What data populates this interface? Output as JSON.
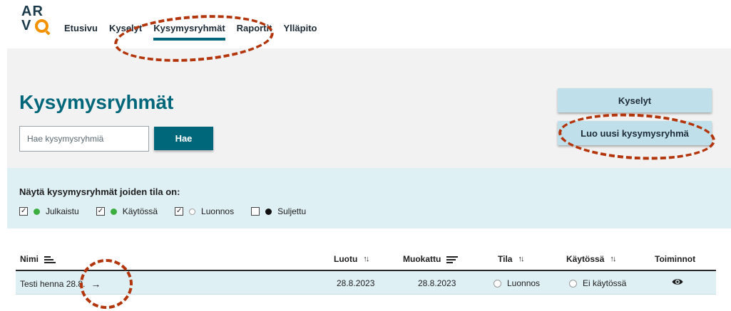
{
  "logo": {
    "line1": "AR",
    "line2": "V"
  },
  "nav": {
    "items": [
      {
        "label": "Etusivu"
      },
      {
        "label": "Kyselyt"
      },
      {
        "label": "Kysymysryhmät"
      },
      {
        "label": "Raportit"
      },
      {
        "label": "Ylläpito"
      }
    ],
    "active": "Kysymysryhmät"
  },
  "page": {
    "title": "Kysymysryhmät"
  },
  "search": {
    "placeholder": "Hae kysymysryhmiä",
    "value": "",
    "button": "Hae"
  },
  "actions": {
    "kyselyt": "Kyselyt",
    "create": "Luo uusi kysymysryhmä"
  },
  "filter": {
    "label": "Näytä kysymysryhmät joiden tila on:",
    "options": [
      {
        "label": "Julkaistu",
        "checked": true,
        "dot": "green"
      },
      {
        "label": "Käytössä",
        "checked": true,
        "dot": "green"
      },
      {
        "label": "Luonnos",
        "checked": true,
        "dot": "empty"
      },
      {
        "label": "Suljettu",
        "checked": false,
        "dot": "black"
      }
    ]
  },
  "table": {
    "columns": {
      "name": "Nimi",
      "created": "Luotu",
      "modified": "Muokattu",
      "state": "Tila",
      "in_use": "Käytössä",
      "actions": "Toiminnot"
    },
    "rows": [
      {
        "name": "Testi henna 28.8.",
        "arrow": "→",
        "created": "28.8.2023",
        "modified": "28.8.2023",
        "state": "Luonnos",
        "in_use": "Ei käytössä",
        "action_icon": "eye-icon"
      }
    ]
  },
  "colors": {
    "accent": "#00677b",
    "panel": "#f2f2f2",
    "filter_bg": "#dff0f5",
    "button_light": "#bfe0ea",
    "annotation": "#b3350b",
    "logo_orange": "#f39200"
  }
}
